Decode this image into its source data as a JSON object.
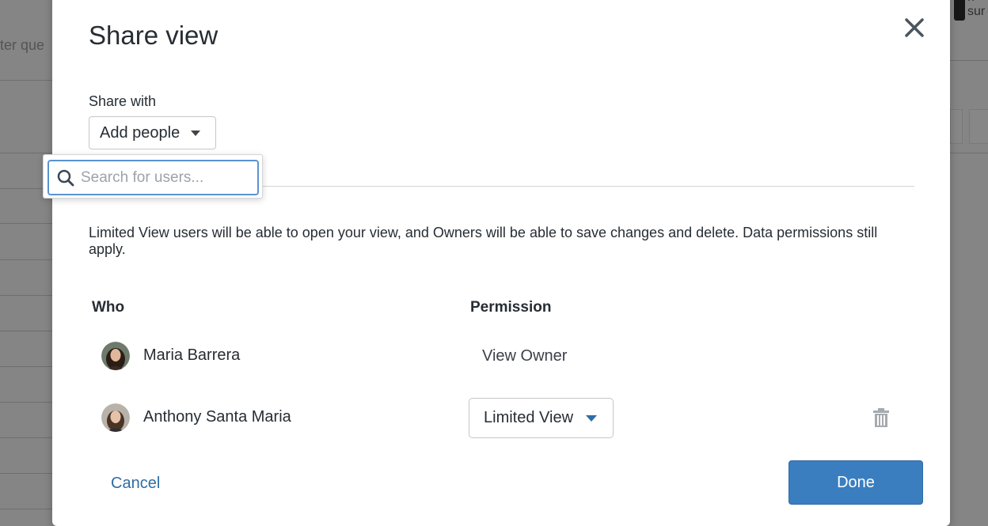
{
  "background": {
    "query_fragment": "ter que",
    "topright_fragment": "n sur"
  },
  "modal": {
    "title": "Share view",
    "share_with_label": "Share with",
    "add_people_label": "Add people",
    "search_placeholder": "Search for users...",
    "info_text": "Limited View users will be able to open your view, and Owners will be able to save changes and delete. Data permissions still apply.",
    "columns": {
      "who": "Who",
      "permission": "Permission"
    },
    "users": [
      {
        "name": "Maria Barrera",
        "permission": "View Owner"
      },
      {
        "name": "Anthony Santa Maria",
        "permission": "Limited View"
      }
    ],
    "cancel_label": "Cancel",
    "done_label": "Done"
  },
  "colors": {
    "accent": "#3a7ec0",
    "link": "#2e6da4",
    "focus_ring": "#5a93d1",
    "text": "#262d33"
  },
  "icons": [
    "close-icon",
    "chevron-down-icon",
    "search-icon",
    "trash-icon"
  ]
}
